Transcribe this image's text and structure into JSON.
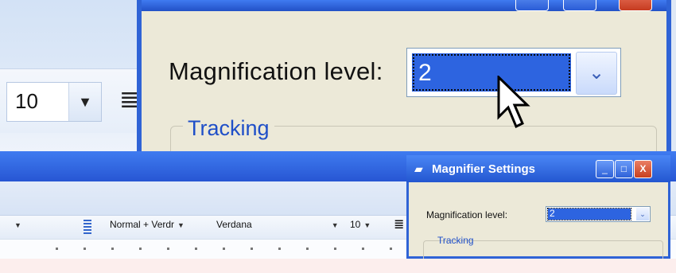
{
  "zoomed": {
    "font_size_value": "10",
    "magnification_label": "Magnification level:",
    "magnification_value": "2",
    "tracking_label": "Tracking"
  },
  "word_toolbar": {
    "style_value": "Normal + Verdr",
    "font_value": "Verdana",
    "size_value": "10"
  },
  "magnifier_dialog": {
    "title": "Magnifier Settings",
    "magnification_label": "Magnification level:",
    "magnification_value": "2",
    "tracking_label": "Tracking",
    "minimize_glyph": "_",
    "maximize_glyph": "□",
    "close_glyph": "X"
  },
  "icons": [
    "chevron-down-icon",
    "align-icon",
    "mouse-pointer-icon",
    "magnifier-app-icon"
  ],
  "colors": {
    "selection": "#2d64e0",
    "xp_title_blue": "#2756d3",
    "dialog_face": "#ece9d8",
    "group_label": "#1f4fc8",
    "close_red": "#c8401f",
    "page_background": "#fceeed"
  }
}
